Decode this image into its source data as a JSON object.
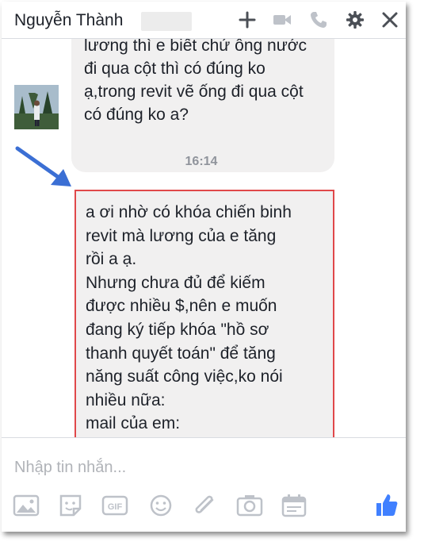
{
  "header": {
    "contact_name": "Nguyễn Thành",
    "icons": [
      "add-icon",
      "video-call-icon",
      "phone-call-icon",
      "settings-icon",
      "close-icon"
    ]
  },
  "messages": [
    {
      "sender": "contact",
      "text": "lương thì e biết chứ ông nước đi qua cột thì có đúng ko ạ,trong revit vẽ ống đi qua cột có đúng ko a?"
    },
    {
      "timestamp": "16:14"
    },
    {
      "sender": "me",
      "text": "a ơi nhờ có khóa chiến binh\nrevit mà lương của e tăng\nrồi a ạ.\nNhưng chưa đủ để kiếm\nđược nhiều $,nên e muốn\nđang ký tiếp khóa \"hồ sơ\nthanh quyết toán\" để tăng\nnăng suất công việc,ko nói\nnhiều nữa:\nmail của em:"
    }
  ],
  "composer": {
    "placeholder": "Nhập tin nhắn...",
    "gif_label": "GIF",
    "toolbar_icons": [
      "photo-icon",
      "sticker-icon",
      "gif-icon",
      "emoji-icon",
      "attachment-icon",
      "camera-icon",
      "calendar-icon",
      "like-icon"
    ]
  },
  "colors": {
    "accent": "#4080ff",
    "annotation_arrow": "#3b6fd4",
    "highlight_border": "#e0484a",
    "bubble_bg": "#f1f0f0"
  }
}
